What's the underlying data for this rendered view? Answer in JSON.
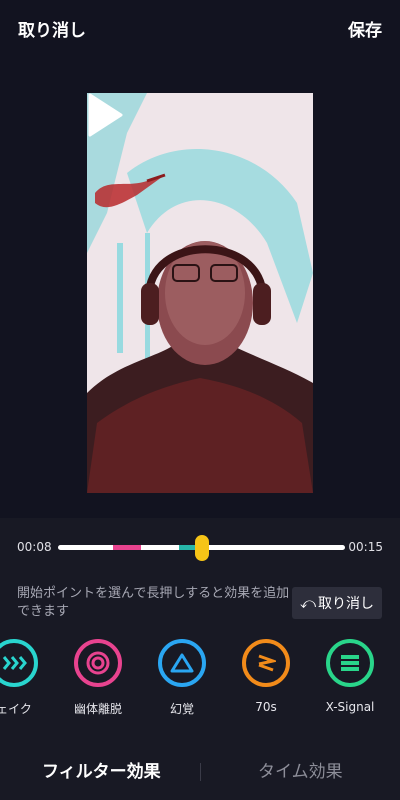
{
  "header": {
    "undo_label": "取り消し",
    "save_label": "保存"
  },
  "timeline": {
    "start_time": "00:08",
    "end_time": "00:15"
  },
  "hint": {
    "text": "開始ポイントを選んで長押しすると効果を追加できます"
  },
  "undo_button": {
    "label": "取り消し",
    "icon": "undo-arrow-icon"
  },
  "effects": [
    {
      "label": "ェイク",
      "color": "#29d5cf",
      "icon": "shake-icon"
    },
    {
      "label": "幽体離脱",
      "color": "#e8438f",
      "icon": "soul-icon"
    },
    {
      "label": "幻覚",
      "color": "#2aa6f2",
      "icon": "triangle-icon"
    },
    {
      "label": "70s",
      "color": "#f28b1a",
      "icon": "70s-icon"
    },
    {
      "label": "X-Signal",
      "color": "#29d58a",
      "icon": "stack-icon"
    }
  ],
  "tabs": {
    "filter_label": "フィルター効果",
    "time_label": "タイム効果"
  },
  "colors": {
    "pink_segment": "#e8438f",
    "teal_segment": "#27b6a9",
    "handle": "#f6c417"
  }
}
